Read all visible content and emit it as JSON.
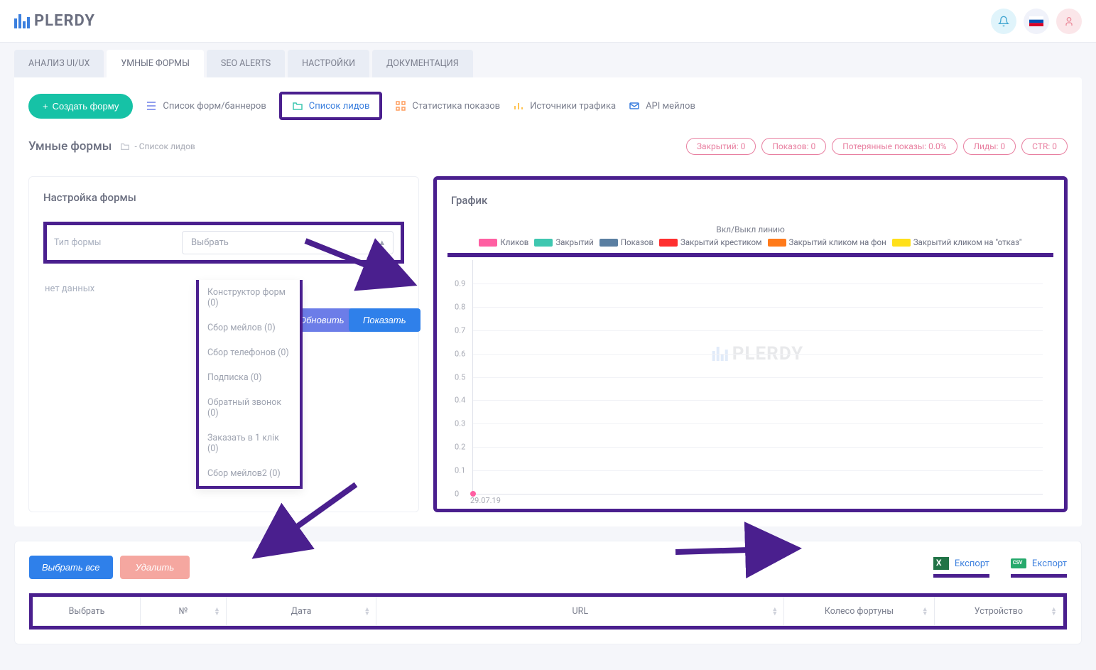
{
  "brand": "PLERDY",
  "tabs": [
    "АНАЛИЗ UI/UX",
    "УМНЫЕ ФОРМЫ",
    "SEO ALERTS",
    "НАСТРОЙКИ",
    "ДОКУМЕНТАЦИЯ"
  ],
  "active_tab": 1,
  "toolbar": {
    "create": "Создать форму",
    "links": [
      "Список форм/баннеров",
      "Список лидов",
      "Статистика показов",
      "Источники трафика",
      "API мейлов"
    ]
  },
  "page": {
    "title": "Умные формы",
    "crumb": "- Список лидов"
  },
  "stats": [
    {
      "label": "Закрытий:",
      "value": "0"
    },
    {
      "label": "Показов:",
      "value": "0"
    },
    {
      "label": "Потерянные показы:",
      "value": "0.0%"
    },
    {
      "label": "Лиды:",
      "value": "0"
    },
    {
      "label": "CTR:",
      "value": "0"
    }
  ],
  "form_panel": {
    "title": "Настройка формы",
    "type_label": "Тип формы",
    "select_placeholder": "Выбрать",
    "options": [
      "Конструктор форм (0)",
      "Сбор мейлов (0)",
      "Сбор телефонов (0)",
      "Подписка (0)",
      "Обратный звонок (0)",
      "Заказать в 1 клік (0)",
      "Сбор мейлов2 (0)"
    ],
    "nodata": "нет данных",
    "refresh": "Обновить",
    "show": "Показать"
  },
  "chart": {
    "title": "График",
    "toggle_label": "Вкл/Выкл линию",
    "legend": [
      {
        "color": "#ff5fa2",
        "label": "Кликов"
      },
      {
        "color": "#3fc7b0",
        "label": "Закрытий"
      },
      {
        "color": "#5a7fa2",
        "label": "Показов"
      },
      {
        "color": "#ff2f2f",
        "label": "Закрытий крестиком"
      },
      {
        "color": "#ff7a1a",
        "label": "Закрытий кликом на фон"
      },
      {
        "color": "#ffe01a",
        "label": "Закрытий кликом на \"отказ\""
      }
    ]
  },
  "chart_data": {
    "type": "line",
    "title": "График",
    "x": [
      "29.07.19"
    ],
    "ylim": [
      0,
      1
    ],
    "yticks": [
      0,
      0.1,
      0.2,
      0.3,
      0.4,
      0.5,
      0.6,
      0.7,
      0.8,
      0.9
    ],
    "series": [
      {
        "name": "Кликов",
        "color": "#ff5fa2",
        "values": [
          0
        ]
      },
      {
        "name": "Закрытий",
        "color": "#3fc7b0",
        "values": [
          0
        ]
      },
      {
        "name": "Показов",
        "color": "#5a7fa2",
        "values": [
          0
        ]
      },
      {
        "name": "Закрытий крестиком",
        "color": "#ff2f2f",
        "values": [
          0
        ]
      },
      {
        "name": "Закрытий кликом на фон",
        "color": "#ff7a1a",
        "values": [
          0
        ]
      },
      {
        "name": "Закрытий кликом на \"отказ\"",
        "color": "#ffe01a",
        "values": [
          0
        ]
      }
    ]
  },
  "bottom": {
    "select_all": "Выбрать все",
    "delete": "Удалить",
    "export": "Експорт",
    "columns": [
      "Выбрать",
      "№",
      "Дата",
      "URL",
      "Колесо фортуны",
      "Устройство"
    ]
  }
}
